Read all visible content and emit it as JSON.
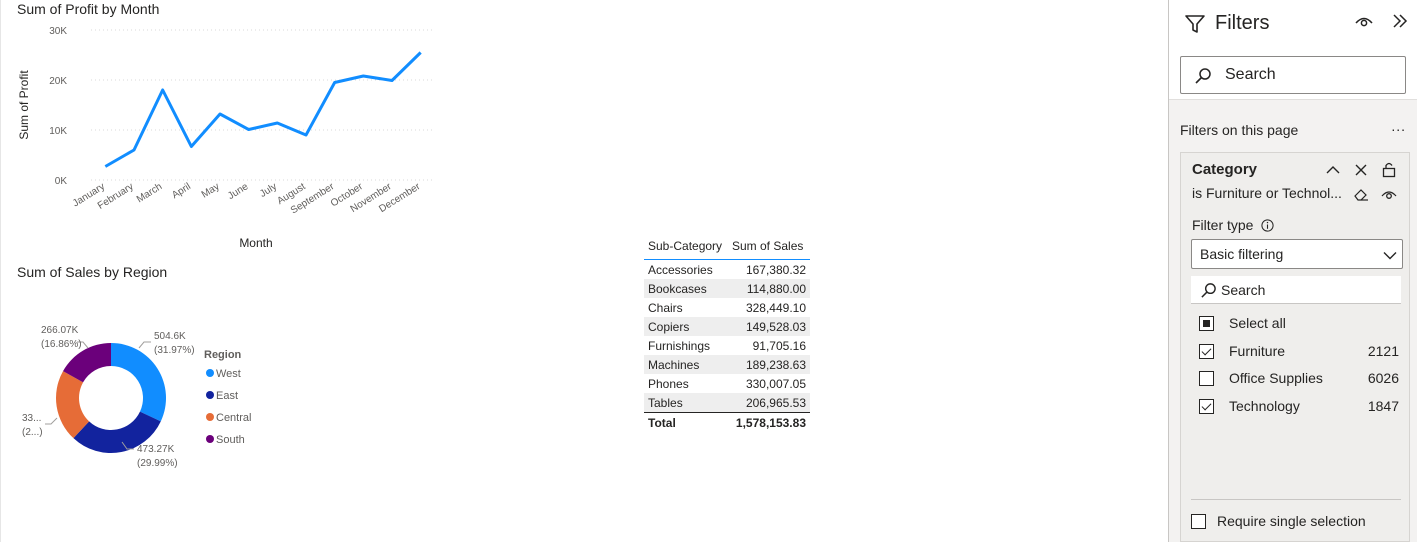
{
  "line_chart": {
    "title": "Sum of Profit by Month",
    "xlabel": "Month",
    "ylabel": "Sum of Profit",
    "yticks": [
      "0K",
      "10K",
      "20K",
      "30K"
    ],
    "color": "#118dff"
  },
  "donut_chart": {
    "title": "Sum of Sales by Region",
    "legend_title": "Region",
    "slices": [
      {
        "name": "West",
        "label_value": "504.6K",
        "label_pct": "(31.97%)",
        "color": "#118dff"
      },
      {
        "name": "East",
        "label_value": "473.27K",
        "label_pct": "(29.99%)",
        "color": "#12239e"
      },
      {
        "name": "Central",
        "label_value": "33...",
        "label_pct": "(2...)",
        "color": "#e66c37"
      },
      {
        "name": "South",
        "label_value": "266.07K",
        "label_pct": "(16.86%)",
        "color": "#6b007b"
      }
    ]
  },
  "chart_data": [
    {
      "type": "line",
      "title": "Sum of Profit by Month",
      "xlabel": "Month",
      "ylabel": "Sum of Profit",
      "x": [
        "January",
        "February",
        "March",
        "April",
        "May",
        "June",
        "July",
        "August",
        "September",
        "October",
        "November",
        "December"
      ],
      "y": [
        2700,
        6000,
        18000,
        6700,
        13200,
        10100,
        11400,
        9000,
        19500,
        20800,
        19900,
        25500
      ],
      "ylim": [
        0,
        30000
      ],
      "grid": true
    },
    {
      "type": "pie",
      "title": "Sum of Sales by Region",
      "categories": [
        "West",
        "East",
        "Central",
        "South"
      ],
      "values": [
        504600,
        473270,
        334000,
        266070
      ],
      "percentages": [
        31.97,
        29.99,
        21.18,
        16.86
      ],
      "legend": "right"
    },
    {
      "type": "table",
      "columns": [
        "Sub-Category",
        "Sum of Sales"
      ],
      "rows": [
        [
          "Accessories",
          "167,380.32"
        ],
        [
          "Bookcases",
          "114,880.00"
        ],
        [
          "Chairs",
          "328,449.10"
        ],
        [
          "Copiers",
          "149,528.03"
        ],
        [
          "Furnishings",
          "91,705.16"
        ],
        [
          "Machines",
          "189,238.63"
        ],
        [
          "Phones",
          "330,007.05"
        ],
        [
          "Tables",
          "206,965.53"
        ]
      ],
      "total": [
        "Total",
        "1,578,153.83"
      ]
    }
  ],
  "table": {
    "headers": [
      "Sub-Category",
      "Sum of Sales"
    ],
    "rows": [
      {
        "name": "Accessories",
        "value": "167,380.32"
      },
      {
        "name": "Bookcases",
        "value": "114,880.00"
      },
      {
        "name": "Chairs",
        "value": "328,449.10"
      },
      {
        "name": "Copiers",
        "value": "149,528.03"
      },
      {
        "name": "Furnishings",
        "value": "91,705.16"
      },
      {
        "name": "Machines",
        "value": "189,238.63"
      },
      {
        "name": "Phones",
        "value": "330,007.05"
      },
      {
        "name": "Tables",
        "value": "206,965.53"
      }
    ],
    "total_label": "Total",
    "total_value": "1,578,153.83"
  },
  "filters_pane": {
    "title": "Filters",
    "search_placeholder": "Search",
    "section_label": "Filters on this page",
    "more_label": "...",
    "card": {
      "field": "Category",
      "summary": "is Furniture or Technol...",
      "filter_type_label": "Filter type",
      "filter_type_value": "Basic filtering",
      "search_placeholder": "Search",
      "options": [
        {
          "label": "Select all",
          "count": "",
          "state": "partial"
        },
        {
          "label": "Furniture",
          "count": "2121",
          "state": "checked"
        },
        {
          "label": "Office Supplies",
          "count": "6026",
          "state": "unchecked"
        },
        {
          "label": "Technology",
          "count": "1847",
          "state": "checked"
        }
      ],
      "require_single_label": "Require single selection"
    }
  }
}
